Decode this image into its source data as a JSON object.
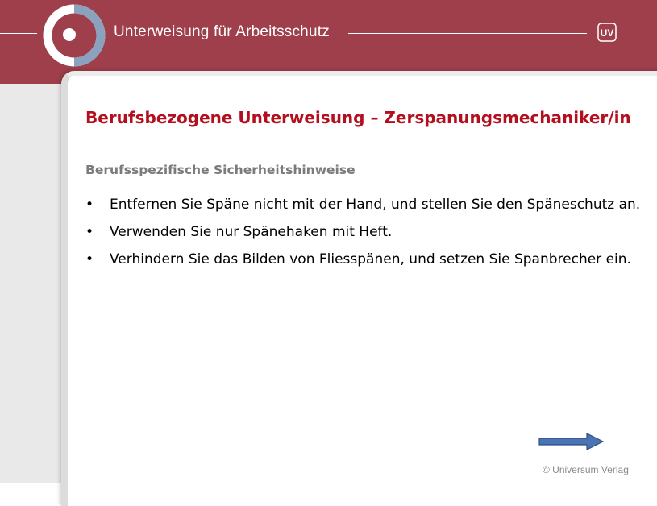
{
  "header": {
    "title": "Unterweisung für Arbeitsschutz",
    "badge_text": "UV",
    "logo_icon": "logo-ring-icon",
    "badge_icon": "uv-badge-icon"
  },
  "slide": {
    "title": "Berufsbezogene Unterweisung – Zerspanungsmechaniker/in",
    "subtitle": "Berufsspezifische Sicherheitshinweise",
    "bullets": [
      "Entfernen Sie Späne nicht mit der Hand, und stellen Sie den Späneschutz an.",
      "Verwenden Sie nur Spänehaken mit Heft.",
      "Verhindern Sie das Bilden von Fliesspänen, und setzen Sie Spanbrecher ein."
    ],
    "bullet_symbol": "•"
  },
  "footer": {
    "copyright": "© Universum Verlag",
    "next_icon": "arrow-right-icon"
  },
  "colors": {
    "header_bg": "#9e3f4b",
    "title_red": "#b30f1e",
    "arrow_blue": "#4a74b4"
  }
}
